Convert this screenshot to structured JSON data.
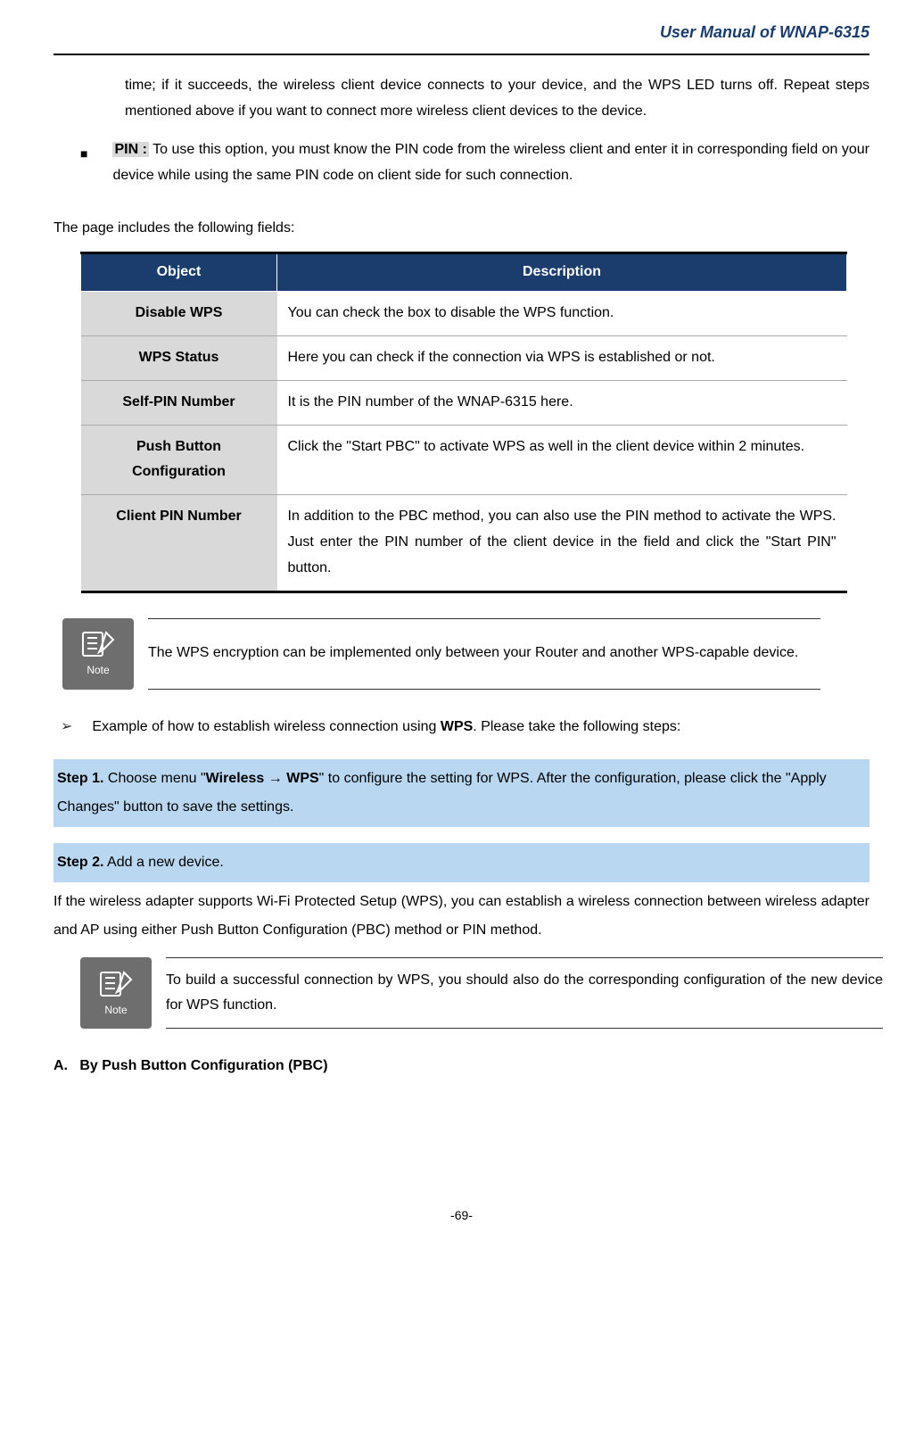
{
  "header": {
    "title": "User Manual of WNAP-6315"
  },
  "para_top": "time; if it succeeds, the wireless client device connects to your device, and the WPS LED turns off. Repeat steps mentioned above if you want to connect more wireless client devices to the device.",
  "pin": {
    "label": "PIN :",
    "text": "To use this option, you must know the PIN code from the wireless client and enter it in corresponding field on your device while using the same PIN code on client side for such connection."
  },
  "fields_intro": "The page includes the following fields:",
  "table": {
    "headers": {
      "obj": "Object",
      "desc": "Description"
    },
    "rows": [
      {
        "obj": "Disable WPS",
        "desc": "You can check the box to disable the WPS function."
      },
      {
        "obj": "WPS Status",
        "desc": "Here you can check if the connection via WPS is established or not."
      },
      {
        "obj": "Self-PIN Number",
        "desc": "It is the PIN number of the WNAP-6315 here."
      },
      {
        "obj": "Push Button Configuration",
        "desc": "Click the \"Start PBC\" to activate WPS as well in the client device within 2 minutes."
      },
      {
        "obj": "Client PIN Number",
        "desc": "In addition to the PBC method, you can also use the PIN method to activate the WPS. Just enter the PIN number of the client device in the field and click the \"Start PIN\" button."
      }
    ]
  },
  "note_label": "Note",
  "note1": "The WPS encryption can be implemented only between your Router and another WPS-capable device.",
  "example_line_pre": "Example of how to establish wireless connection using ",
  "example_line_bold": "WPS",
  "example_line_post": ". Please take the following steps:",
  "step1": {
    "label": "Step 1.",
    "pre": "  Choose menu \"",
    "b1": "Wireless",
    "arrow": " → ",
    "b2": "WPS",
    "post": "\" to configure the setting for WPS. After the configuration, please click the \"Apply Changes\" button to save the settings."
  },
  "step2": {
    "label": "Step 2.",
    "text": "  Add a new device."
  },
  "step2_after": "If the wireless adapter supports Wi-Fi Protected Setup (WPS), you can establish a wireless connection between wireless adapter and AP using either Push Button Configuration (PBC) method or PIN method.",
  "note2": "To build a successful connection by WPS, you should also do the corresponding configuration of the new device for WPS function.",
  "section_a": {
    "letter": "A.",
    "title": "By Push Button Configuration (PBC)"
  },
  "page_number": "-69-"
}
